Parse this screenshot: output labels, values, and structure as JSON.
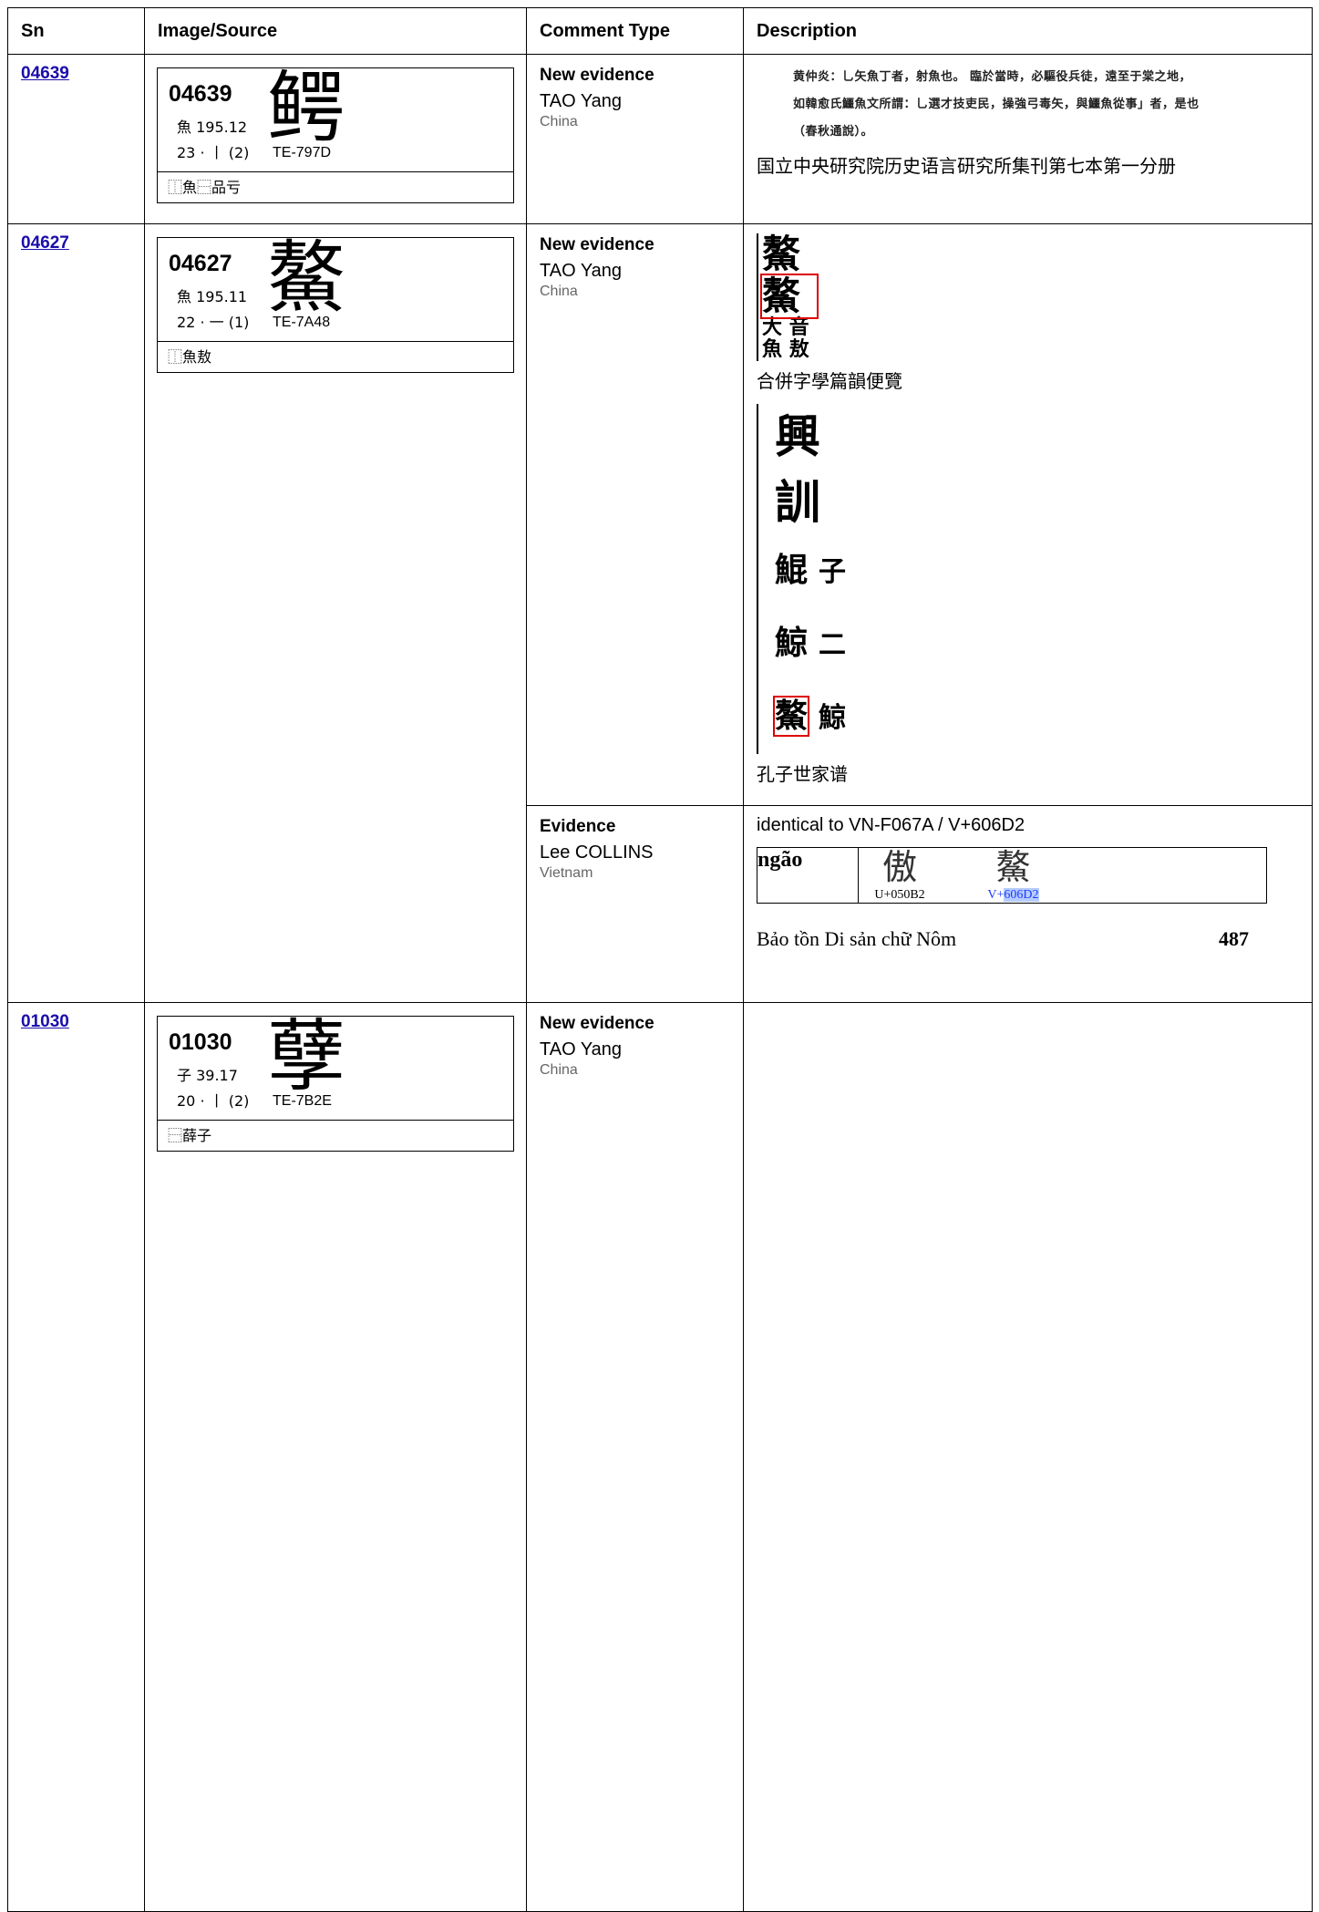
{
  "headers": [
    "Sn",
    "Image/Source",
    "Comment Type",
    "Description"
  ],
  "rows": [
    {
      "sn": "04639",
      "card": {
        "id": "04639",
        "radical": "魚 195.12",
        "strokes": "23 · 丨 (2)",
        "te": "TE-797D",
        "glyph": "鳄",
        "ids": "⿰魚⿱品亏"
      },
      "comments": [
        {
          "type": "New evidence",
          "author": "TAO Yang",
          "country": "China",
          "scan_lines": [
            "黄仲炎：乚矢魚丁者，射魚也。 臨於當時，必驅役兵徒，遠至于棠之地，",
            "如韓愈氏鱷魚文所謂：乚選才技吏民，操強弓毒矢，與鱷魚從事」者，是也",
            "（春秋通說）。"
          ],
          "caption": "国立中央研究院历史语言研究所集刊第七本第一分册"
        }
      ]
    },
    {
      "sn": "04627",
      "card": {
        "id": "04627",
        "radical": "魚 195.11",
        "strokes": "22 · 一 (1)",
        "te": "TE-7A48",
        "glyph": "鰲",
        "ids": "⿰魚敖"
      },
      "comments": [
        {
          "type": "New evidence",
          "author": "TAO Yang",
          "country": "China",
          "strip_top": "鰲",
          "strip_mid": "鰲",
          "strip_small1": "大 音",
          "strip_small2": "魚 敖",
          "caption1": "合併字學篇韻便覽",
          "big1": "興",
          "big2": "訓",
          "pair1a": "鯤",
          "pair1b": "子",
          "pair2a": "鯨",
          "pair2b": "二",
          "pair3a": "鰲",
          "pair3b": "鯨",
          "caption2": "孔子世家谱"
        },
        {
          "type": "Evidence",
          "author": "Lee COLLINS",
          "country": "Vietnam",
          "text": "identical to VN-F067A / V+606D2",
          "vn_label": "ngão",
          "vn_glyph1": "傲",
          "vn_code1": "U+050B2",
          "vn_glyph2": "鰲",
          "vn_code2_prefix": "V+",
          "vn_code2_hl": "606D2",
          "vn_source": "Bảo tồn Di sản chữ Nôm",
          "vn_page": "487"
        }
      ]
    },
    {
      "sn": "01030",
      "card": {
        "id": "01030",
        "radical": "子 39.17",
        "strokes": "20 · 丨 (2)",
        "te": "TE-7B2E",
        "glyph": "孽",
        "ids": "⿱薛子"
      },
      "comments": [
        {
          "type": "New evidence",
          "author": "TAO Yang",
          "country": "China"
        }
      ]
    }
  ]
}
